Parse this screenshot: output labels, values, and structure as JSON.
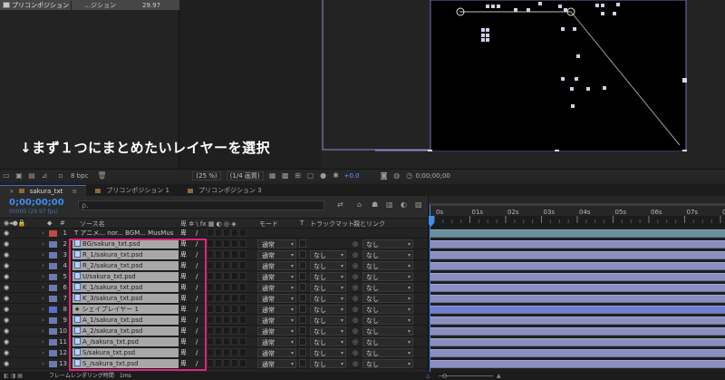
{
  "project": {
    "item_name": "プリコンポジション",
    "item_type": "…ジション",
    "item_fps": "29.97"
  },
  "caption": "↓まず１つにまとめたいレイヤーを選択",
  "viewer_toolbar": {
    "bpc": "8 bpc",
    "zoom": "(25 %)",
    "resolution": "(1/4 画質)",
    "exposure": "+0.0",
    "timecode": "0;00;00;00"
  },
  "tabs": [
    {
      "label": "sakura_txt",
      "active": true
    },
    {
      "label": "プリコンポジション 1",
      "active": false
    },
    {
      "label": "プリコンポジション 3",
      "active": false
    }
  ],
  "timeline": {
    "timecode": "0;00;00;00",
    "timecode_sub": "00000 (29.97 fps)",
    "search_placeholder": "ρ.",
    "columns": {
      "source_name": "ソース名",
      "mode": "モード",
      "t": "T",
      "track_matte": "トラックマット",
      "parent": "親とリンク"
    },
    "ruler_labels": [
      "0s",
      "01s",
      "02s",
      "03s",
      "04s",
      "05s",
      "06s",
      "07s",
      "08s"
    ],
    "layers": [
      {
        "num": "1",
        "name": "アニメ... nor... BGM... MusMus",
        "label_color": "#c24a4a",
        "kind": "text",
        "selected": false,
        "mode": "",
        "matte": "",
        "parent": ""
      },
      {
        "num": "2",
        "name": "BG/sakura_txt.psd",
        "label_color": "#6b7bb0",
        "kind": "file",
        "selected": true,
        "mode": "通常",
        "matte": "",
        "parent": "なし"
      },
      {
        "num": "3",
        "name": "R_1/sakura_txt.psd",
        "label_color": "#6b7bb0",
        "kind": "file",
        "selected": true,
        "mode": "通常",
        "matte": "なし",
        "parent": "なし"
      },
      {
        "num": "4",
        "name": "R_2/sakura_txt.psd",
        "label_color": "#6b7bb0",
        "kind": "file",
        "selected": true,
        "mode": "通常",
        "matte": "なし",
        "parent": "なし"
      },
      {
        "num": "5",
        "name": "U/sakura_txt.psd",
        "label_color": "#6b7bb0",
        "kind": "file",
        "selected": true,
        "mode": "通常",
        "matte": "なし",
        "parent": "なし"
      },
      {
        "num": "6",
        "name": "K_1/sakura_txt.psd",
        "label_color": "#6b7bb0",
        "kind": "file",
        "selected": true,
        "mode": "通常",
        "matte": "なし",
        "parent": "なし"
      },
      {
        "num": "7",
        "name": "K_3/sakura_txt.psd",
        "label_color": "#6b7bb0",
        "kind": "file",
        "selected": true,
        "mode": "通常",
        "matte": "なし",
        "parent": "なし"
      },
      {
        "num": "8",
        "name": "シェイプレイヤー 1",
        "label_color": "#5a6fd0",
        "kind": "shape",
        "selected": true,
        "mode": "通常",
        "matte": "なし",
        "parent": "なし"
      },
      {
        "num": "9",
        "name": "A_1/sakura_txt.psd",
        "label_color": "#6b7bb0",
        "kind": "file",
        "selected": true,
        "mode": "通常",
        "matte": "なし",
        "parent": "なし"
      },
      {
        "num": "10",
        "name": "A_2/sakura_txt.psd",
        "label_color": "#6b7bb0",
        "kind": "file",
        "selected": true,
        "mode": "通常",
        "matte": "なし",
        "parent": "なし"
      },
      {
        "num": "11",
        "name": "A_/sakura_txt.psd",
        "label_color": "#6b7bb0",
        "kind": "file",
        "selected": true,
        "mode": "通常",
        "matte": "なし",
        "parent": "なし"
      },
      {
        "num": "12",
        "name": "S/sakura_txt.psd",
        "label_color": "#6b7bb0",
        "kind": "file",
        "selected": true,
        "mode": "通常",
        "matte": "なし",
        "parent": "なし"
      },
      {
        "num": "13",
        "name": "S_/sakura_txt.psd",
        "label_color": "#6b7bb0",
        "kind": "file",
        "selected": true,
        "mode": "通常",
        "matte": "なし",
        "parent": "なし"
      }
    ]
  },
  "status": {
    "render_label": "フレームレンダリング時間",
    "render_time": "1ms"
  },
  "colors": {
    "accent_blue": "#3e8df0",
    "selection_pink": "#e0247a",
    "track_bar": "#8b8fbf"
  }
}
